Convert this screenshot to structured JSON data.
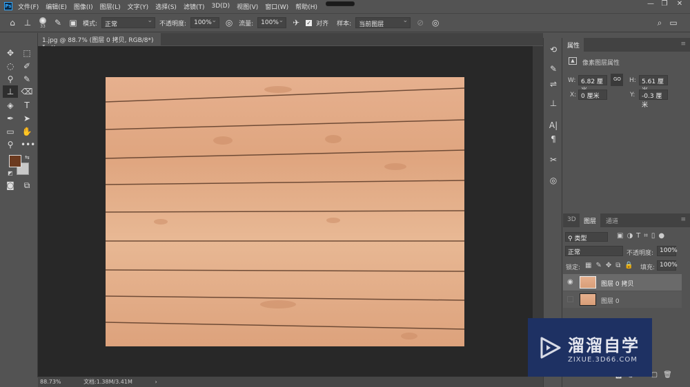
{
  "app": {
    "logo": "Ps"
  },
  "menu": [
    "文件(F)",
    "编辑(E)",
    "图像(I)",
    "图层(L)",
    "文字(Y)",
    "选择(S)",
    "滤镜(T)",
    "3D(D)",
    "视图(V)",
    "窗口(W)",
    "帮助(H)"
  ],
  "window_controls": {
    "minimize": "—",
    "restore": "❐",
    "close": "✕"
  },
  "options": {
    "brush_size": "33",
    "mode_label": "模式:",
    "mode_value": "正常",
    "opacity_label": "不透明度:",
    "opacity_value": "100%",
    "flow_label": "流量:",
    "flow_value": "100%",
    "align_label": "对齐",
    "align_checked": true,
    "sample_label": "样本:",
    "sample_value": "当前图层"
  },
  "document_tab": {
    "title": "1.jpg @ 88.7% (图层 0 拷贝, RGB/8*) *",
    "close": "×"
  },
  "colors": {
    "foreground": "#6b3a1f",
    "background": "#c8c8c8",
    "accent": "#1e3163"
  },
  "status": {
    "zoom": "88.73%",
    "doc": "文档:1.38M/3.41M",
    "arrow": "›"
  },
  "properties": {
    "tab": "属性",
    "header": "像素图层属性",
    "w_label": "W:",
    "w_value": "6.82 厘米",
    "h_label": "H:",
    "h_value": "5.61 厘米",
    "x_label": "X:",
    "x_value": "0 厘米",
    "y_label": "Y:",
    "y_value": "-0.3 厘米",
    "link": "GO"
  },
  "layers": {
    "tabs": [
      "3D",
      "图层",
      "通道"
    ],
    "active_tab": 1,
    "filter": "类型",
    "blend": "正常",
    "opacity_label": "不透明度:",
    "opacity_value": "100%",
    "lock_label": "锁定:",
    "fill_label": "填充:",
    "fill_value": "100%",
    "items": [
      {
        "name": "图层 0 拷贝",
        "visible": true,
        "selected": true
      },
      {
        "name": "图层 0",
        "visible": false,
        "selected": false
      }
    ]
  },
  "watermark": {
    "title": "溜溜自学",
    "url": "ZIXUE.3D66.COM"
  }
}
